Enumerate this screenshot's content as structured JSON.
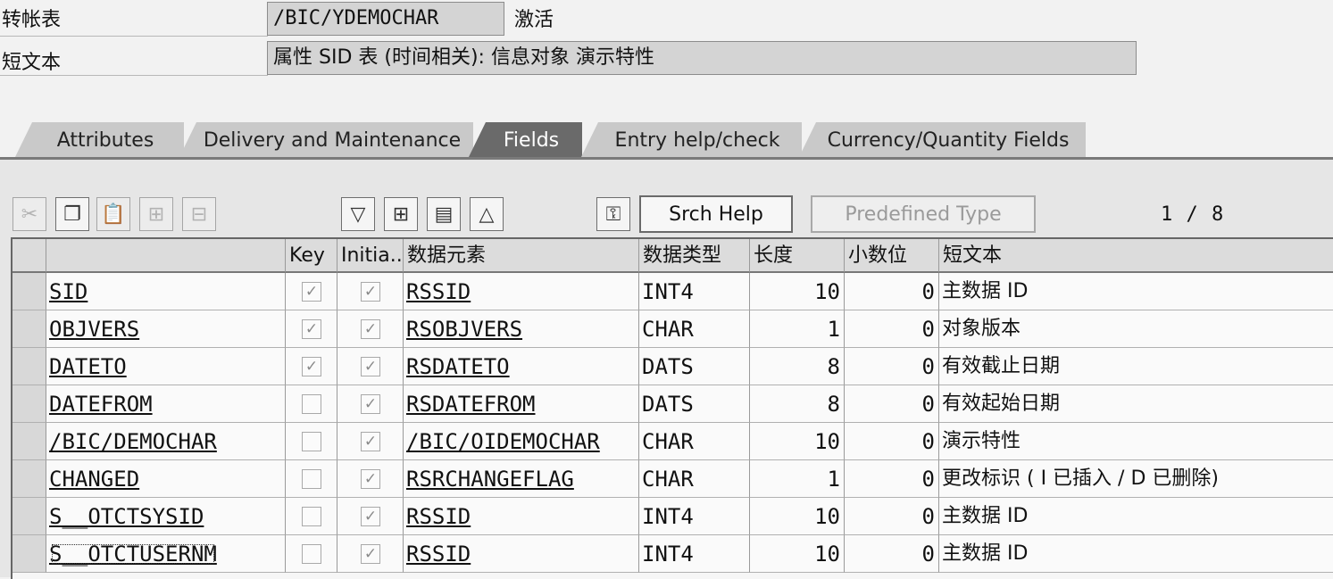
{
  "header": {
    "table_label": "转帐表",
    "table_value": "/BIC/YDEMOCHAR",
    "status": "激活",
    "short_text_label": "短文本",
    "short_text_value": "属性 SID 表 (时间相关): 信息对象 演示特性"
  },
  "tabs": [
    {
      "label": "Attributes",
      "active": false
    },
    {
      "label": "Delivery and Maintenance",
      "active": false
    },
    {
      "label": "Fields",
      "active": true
    },
    {
      "label": "Entry help/check",
      "active": false
    },
    {
      "label": "Currency/Quantity Fields",
      "active": false
    }
  ],
  "toolbar": {
    "icons": [
      "cut-icon",
      "copy-icon",
      "paste-icon",
      "insert-row-icon",
      "delete-row-icon",
      "filter-down-icon",
      "insert-icon",
      "table-icon",
      "filter-up-icon",
      "key-icon"
    ],
    "srch_help_label": "Srch Help",
    "predefined_type_label": "Predefined Type",
    "pager": "1 / 8"
  },
  "grid": {
    "columns": [
      "",
      "Key",
      "Initia...",
      "数据元素",
      "数据类型",
      "长度",
      "小数位",
      "短文本"
    ],
    "rows": [
      {
        "field": "SID",
        "key": true,
        "initial": true,
        "element": "RSSID",
        "type": "INT4",
        "length": "10",
        "decimals": "0",
        "text": "主数据 ID"
      },
      {
        "field": "OBJVERS",
        "key": true,
        "initial": true,
        "element": "RSOBJVERS",
        "type": "CHAR",
        "length": "1",
        "decimals": "0",
        "text": "对象版本"
      },
      {
        "field": "DATETO",
        "key": true,
        "initial": true,
        "element": "RSDATETO",
        "type": "DATS",
        "length": "8",
        "decimals": "0",
        "text": "有效截止日期"
      },
      {
        "field": "DATEFROM",
        "key": false,
        "initial": true,
        "element": "RSDATEFROM",
        "type": "DATS",
        "length": "8",
        "decimals": "0",
        "text": "有效起始日期"
      },
      {
        "field": "/BIC/DEMOCHAR",
        "key": false,
        "initial": true,
        "element": "/BIC/OIDEMOCHAR",
        "type": "CHAR",
        "length": "10",
        "decimals": "0",
        "text": "演示特性"
      },
      {
        "field": "CHANGED",
        "key": false,
        "initial": true,
        "element": "RSRCHANGEFLAG",
        "type": "CHAR",
        "length": "1",
        "decimals": "0",
        "text": "更改标识 ( I 已插入 / D  已删除)"
      },
      {
        "field": "S__OTCTSYSID",
        "key": false,
        "initial": true,
        "element": "RSSID",
        "type": "INT4",
        "length": "10",
        "decimals": "0",
        "text": "主数据 ID"
      },
      {
        "field": "S__OTCTUSERNM",
        "key": false,
        "initial": true,
        "element": "RSSID",
        "type": "INT4",
        "length": "10",
        "decimals": "0",
        "text": "主数据 ID"
      }
    ]
  }
}
